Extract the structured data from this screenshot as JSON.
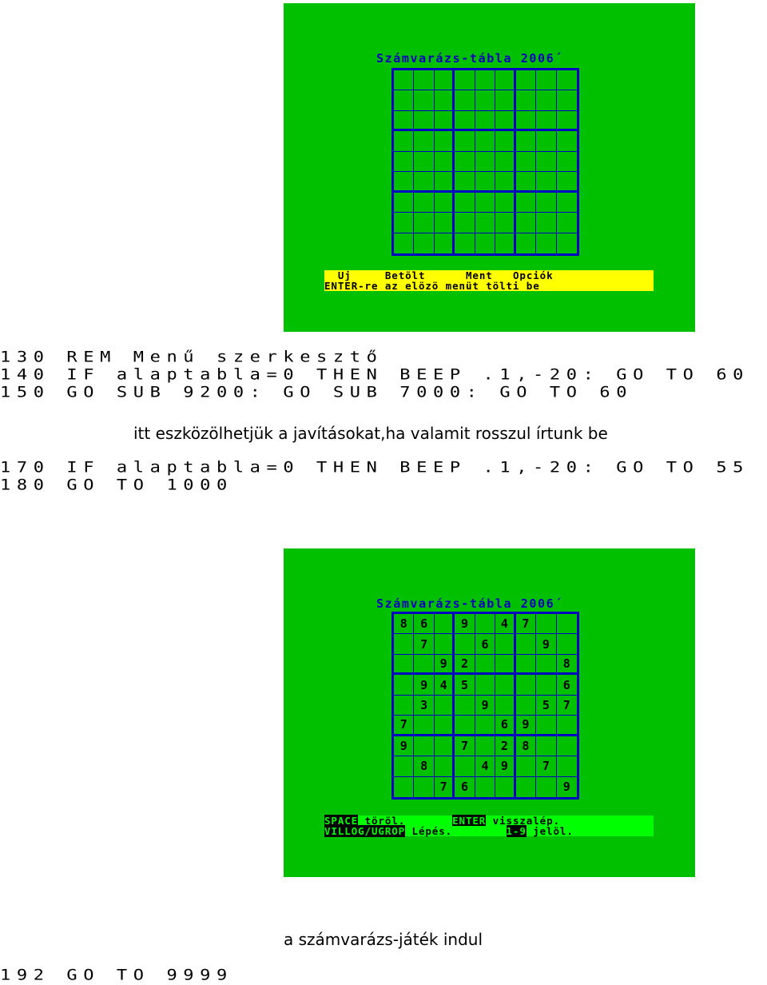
{
  "screen1": {
    "title": "Számvarázs-tábla 2006´",
    "menu": {
      "items": [
        "Uj",
        "Betölt",
        "Ment",
        "Opciók"
      ],
      "hint": "ENTER-re az elözö menüt tölti be"
    }
  },
  "code1": [
    "130 REM Menű szerkesztő",
    "140 IF alaptabla=0 THEN BEEP .1,-20: GO TO 60",
    "150 GO SUB 9200: GO SUB 7000: GO TO 60"
  ],
  "caption1": "itt eszközölhetjük a javításokat,ha valamit rosszul írtunk be",
  "code2": [
    "170 IF alaptabla=0 THEN BEEP .1,-20: GO TO 55",
    "180 GO TO 1000"
  ],
  "screen2": {
    "title": "Számvarázs-tábla 2006´",
    "grid": [
      [
        "8",
        "6",
        "",
        "9",
        "",
        "4",
        "7",
        "",
        ""
      ],
      [
        "",
        "7",
        "",
        "",
        "6",
        "",
        "",
        "9",
        ""
      ],
      [
        "",
        "",
        "9",
        "2",
        "",
        "",
        "",
        "",
        "8"
      ],
      [
        "",
        "9",
        "4",
        "5",
        "",
        "",
        "",
        "",
        "6"
      ],
      [
        "",
        "3",
        "",
        "",
        "9",
        "",
        "",
        "5",
        "7"
      ],
      [
        "7",
        "",
        "",
        "",
        "",
        "6",
        "9",
        "",
        ""
      ],
      [
        "9",
        "",
        "",
        "7",
        "",
        "2",
        "8",
        "",
        ""
      ],
      [
        "",
        "8",
        "",
        "",
        "4",
        "9",
        "",
        "7",
        ""
      ],
      [
        "",
        "",
        "7",
        "6",
        "",
        "",
        "",
        "",
        "9"
      ]
    ],
    "help": {
      "space_key": "SPACE",
      "space_text": " töröl.",
      "enter_key": "ENTER",
      "enter_text": " visszalép.",
      "move_key": "VILLOG/UGROP",
      "move_text": " Lépés.",
      "digit_key": "1-9",
      "digit_text": " jelöl."
    }
  },
  "caption2": "a számvarázs-játék indul",
  "code3": [
    "192 GO TO 9999"
  ],
  "colors": {
    "screen": "#00c000",
    "grid": "#0000c0",
    "menu": "#ffff00",
    "help": "#00ff00"
  }
}
